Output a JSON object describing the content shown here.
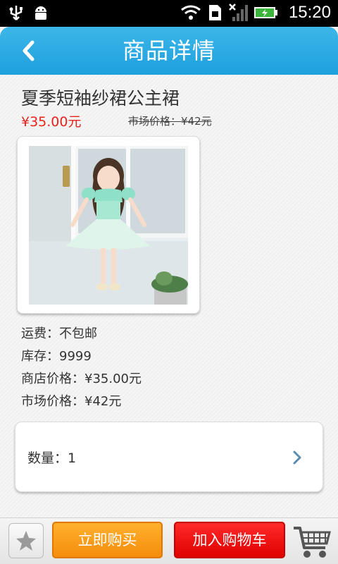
{
  "status_bar": {
    "time": "15:20"
  },
  "header": {
    "title": "商品详情"
  },
  "product": {
    "name": "夏季短袖纱裙公主裙",
    "price": "¥35.00元",
    "market_price": "市场价格：¥42元",
    "image_alt": "girl-in-mint-dress-photo"
  },
  "info": {
    "shipping": "运费：不包邮",
    "stock": "库存：9999",
    "store_price": "商店价格：¥35.00元",
    "market_price": "市场价格：¥42元"
  },
  "quantity": {
    "label": "数量：1"
  },
  "toolbar": {
    "favorite_icon": "star-icon",
    "buy_now_label": "立即购买",
    "add_to_cart_label": "加入购物车",
    "cart_icon": "shopping-cart-icon"
  },
  "colors": {
    "header_blue": "#1ea0de",
    "price_red": "#e8231e",
    "buy_orange": "#f58c0c",
    "cart_red": "#e00000"
  }
}
